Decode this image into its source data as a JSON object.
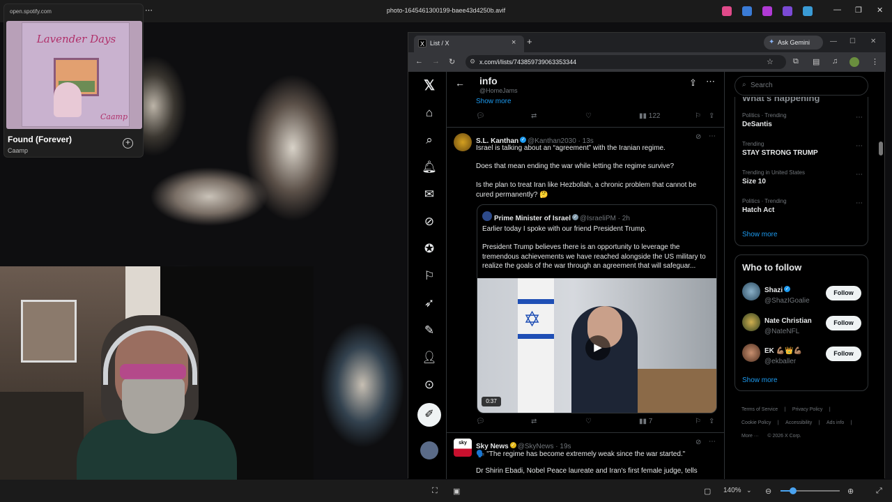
{
  "desktop": {
    "window_title": "photo-1645461300199-baee43d4250b.avif",
    "zoom": "140%"
  },
  "spotify": {
    "url": "open.spotify.com",
    "album_title": "Lavender Days",
    "song": "Found (Forever)",
    "artist": "Caamp",
    "album_artist": "Caamp"
  },
  "browser": {
    "tab_title": "List / X",
    "url": "x.com/i/lists/743859739063353344",
    "gemini": "Ask Gemini"
  },
  "list": {
    "title": "info",
    "handle": "@HomeJams",
    "show_more": "Show more"
  },
  "prev_tweet": {
    "views": "122"
  },
  "tweets": [
    {
      "name": "S.L. Kanthan",
      "handle": "@Kanthan2030 · 13s",
      "lines": [
        "Israel is talking about an “agreement” with the Iranian regime.",
        "Does that mean ending the war while letting the regime survive?",
        "Is the plan to treat Iran like Hezbollah, a chronic problem that cannot be cured permanently? 🤔"
      ],
      "views": "7",
      "quote": {
        "name": "Prime Minister of Israel",
        "handle": "@IsraeliPM · 2h",
        "lines": [
          "Earlier today I spoke with our friend President Trump.",
          "President Trump believes there is an opportunity to leverage the tremendous achievements we have reached alongside the US military to realize the goals of the war through an agreement that will safeguar..."
        ],
        "duration": "0:37"
      }
    },
    {
      "name": "Sky News",
      "handle": "@SkyNews · 19s",
      "line": "🗣️ \"The regime has become extremely weak since the war started.\"",
      "line2": "Dr Shirin Ebadi, Nobel Peace laureate and Iran's first female judge, tells"
    }
  ],
  "sidebar": {
    "search_placeholder": "Search",
    "whats_happening": "What's happening",
    "trends": [
      {
        "category": "Politics · Trending",
        "name": "DeSantis"
      },
      {
        "category": "Trending",
        "name": "STAY STRONG TRUMP"
      },
      {
        "category": "Trending in United States",
        "name": "Size 10"
      },
      {
        "category": "Politics · Trending",
        "name": "Hatch Act"
      }
    ],
    "show_more": "Show more",
    "who_to_follow": "Who to follow",
    "follow": [
      {
        "name": "Shazi",
        "handle": "@ShazIGoalie",
        "button": "Follow"
      },
      {
        "name": "Nate Christian",
        "handle": "@NateNFL",
        "button": "Follow"
      },
      {
        "name": "EK 💪🏽👑💪🏽",
        "handle": "@ekballer",
        "button": "Follow"
      }
    ],
    "follow_show_more": "Show more",
    "footer": [
      "Terms of Service",
      "|",
      "Privacy Policy",
      "|",
      "Cookie Policy",
      "|",
      "Accessibility",
      "|",
      "Ads info",
      "|",
      "More ···",
      "© 2026 X Corp."
    ]
  }
}
